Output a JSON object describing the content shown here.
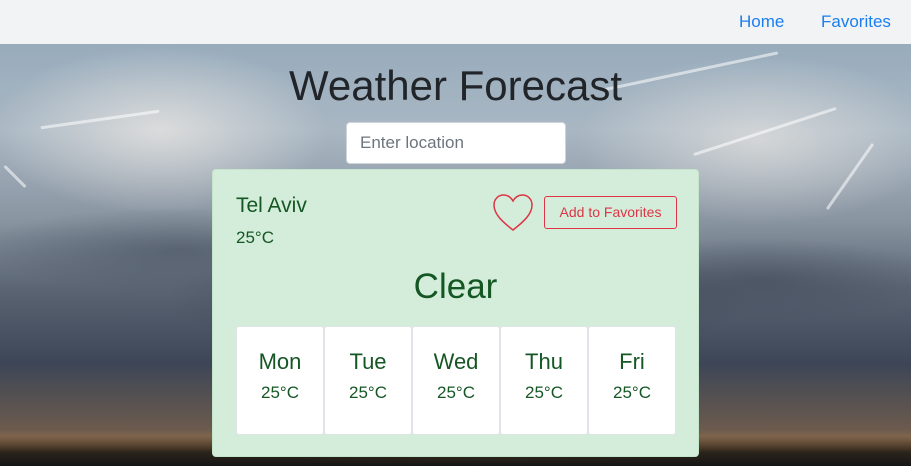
{
  "nav": {
    "home_label": "Home",
    "favorites_label": "Favorites"
  },
  "header": {
    "title": "Weather Forecast"
  },
  "search": {
    "placeholder": "Enter location",
    "value": ""
  },
  "current": {
    "city": "Tel Aviv",
    "temperature": "25°C",
    "condition": "Clear",
    "favorite_button_label": "Add to Favorites",
    "favorite_icon": "heart-outline-icon"
  },
  "forecast": [
    {
      "day": "Mon",
      "temperature": "25°C"
    },
    {
      "day": "Tue",
      "temperature": "25°C"
    },
    {
      "day": "Wed",
      "temperature": "25°C"
    },
    {
      "day": "Thu",
      "temperature": "25°C"
    },
    {
      "day": "Fri",
      "temperature": "25°C"
    }
  ],
  "colors": {
    "link": "#1a7ef0",
    "card_background": "#d4edda",
    "card_text": "#155724",
    "favorite_accent": "#dc3545"
  }
}
